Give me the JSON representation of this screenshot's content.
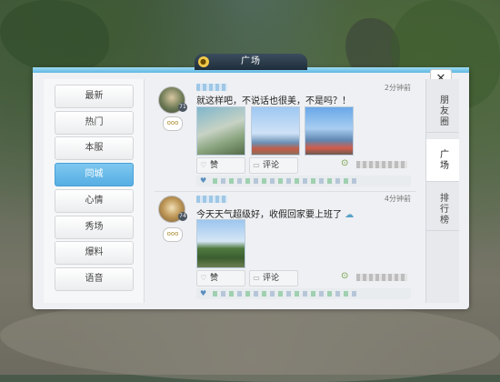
{
  "header": {
    "title": "广场",
    "icon": "coin-icon",
    "close_label": "✕"
  },
  "categories": [
    {
      "label": "最新",
      "active": false
    },
    {
      "label": "热门",
      "active": false
    },
    {
      "label": "本服",
      "active": false
    },
    {
      "label": "同城",
      "active": true
    },
    {
      "label": "心情",
      "active": false
    },
    {
      "label": "秀场",
      "active": false
    },
    {
      "label": "爆料",
      "active": false
    },
    {
      "label": "语音",
      "active": false
    }
  ],
  "right_tabs": [
    {
      "label": "朋友圈",
      "active": false
    },
    {
      "label": "广场",
      "active": true
    },
    {
      "label": "排行榜",
      "active": false
    }
  ],
  "posts": [
    {
      "level": "71",
      "time": "2分钟前",
      "text": "就这样吧，不说话也很美，不是吗？！",
      "like_label": "赞",
      "comment_label": "评论",
      "chat_label": "ooo"
    },
    {
      "level": "74",
      "time": "4分钟前",
      "text": "今天天气超级好，收假回家要上班了",
      "like_label": "赞",
      "comment_label": "评论",
      "chat_label": "ooo"
    }
  ]
}
